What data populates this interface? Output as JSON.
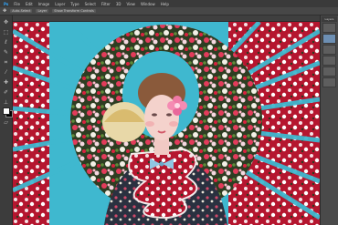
{
  "app": {
    "menu": [
      "Ps",
      "File",
      "Edit",
      "Image",
      "Layer",
      "Type",
      "Select",
      "Filter",
      "3D",
      "View",
      "Window",
      "Help"
    ],
    "options": [
      "Auto-Select",
      "Layer",
      "Show Transform Controls"
    ]
  },
  "document": {
    "tab_label": ""
  },
  "panel": {
    "tab": "Layers"
  },
  "colors": {
    "ui_dark": "#3a3a3a",
    "backdrop_blue": "#3fb8cf",
    "backdrop_red": "#c41e3a",
    "foreground_swatch": "#ffffff",
    "background_swatch": "#000000",
    "selected_layer": "#6d8fb3"
  },
  "icons": [
    "move-icon",
    "marquee-icon",
    "lasso-icon",
    "quick-select-icon",
    "crop-icon",
    "eyedropper-icon",
    "healing-icon",
    "brush-icon",
    "stamp-icon",
    "history-brush-icon",
    "eraser-icon",
    "gradient-icon",
    "blur-icon",
    "dodge-icon",
    "pen-icon",
    "type-icon",
    "path-select-icon",
    "shape-icon",
    "hand-icon",
    "zoom-icon"
  ]
}
